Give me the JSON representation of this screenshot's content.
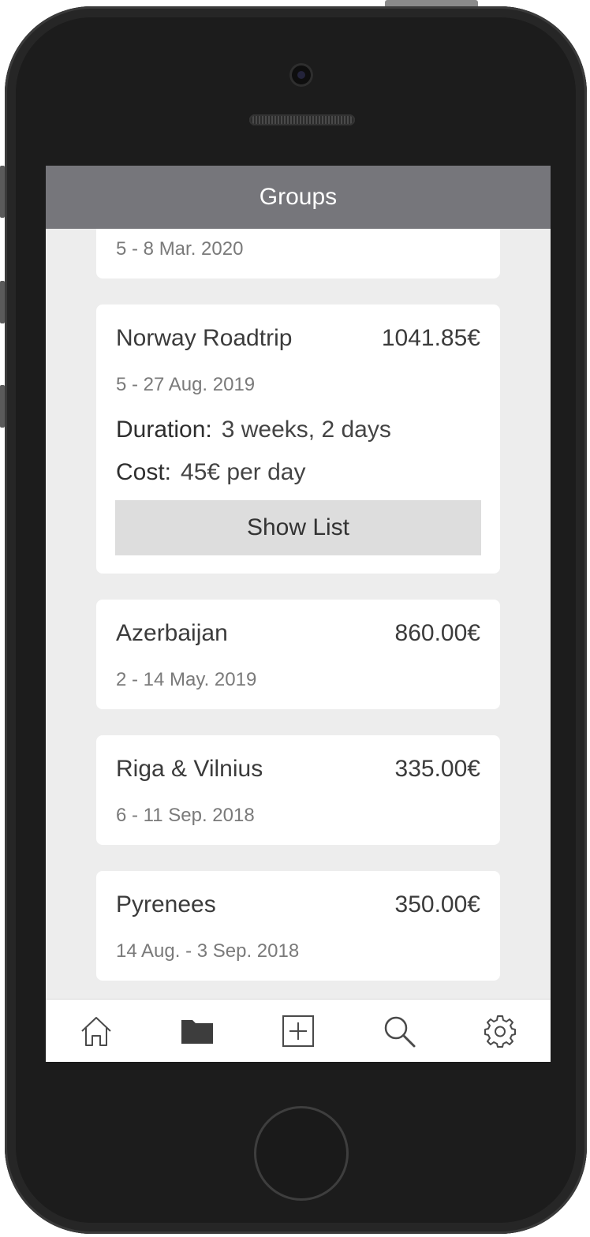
{
  "header": {
    "title": "Groups"
  },
  "partial_card": {
    "dates": "5 - 8 Mar. 2020"
  },
  "expanded_card": {
    "title": "Norway Roadtrip",
    "amount": "1041.85€",
    "dates": "5 - 27 Aug. 2019",
    "duration_label": "Duration:",
    "duration_value": "3 weeks, 2 days",
    "cost_label": "Cost:",
    "cost_value": "45€ per day",
    "button_label": "Show List"
  },
  "groups": [
    {
      "title": "Azerbaijan",
      "amount": "860.00€",
      "dates": "2 - 14 May. 2019"
    },
    {
      "title": "Riga & Vilnius",
      "amount": "335.00€",
      "dates": "6 - 11 Sep. 2018"
    },
    {
      "title": "Pyrenees",
      "amount": "350.00€",
      "dates": "14 Aug. - 3 Sep. 2018"
    }
  ],
  "tabbar": {
    "items": [
      {
        "icon": "home-icon",
        "active": false
      },
      {
        "icon": "folder-icon",
        "active": true
      },
      {
        "icon": "add-icon",
        "active": false
      },
      {
        "icon": "search-icon",
        "active": false
      },
      {
        "icon": "settings-icon",
        "active": false
      }
    ]
  },
  "colors": {
    "header_bg": "#76767b",
    "screen_bg": "#ededed",
    "button_bg": "#dddddd",
    "icon": "#4a4a4a"
  }
}
